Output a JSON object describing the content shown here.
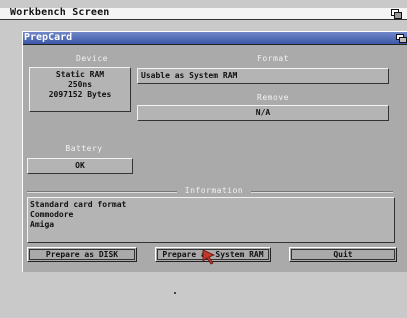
{
  "screen": {
    "title": "Workbench Screen"
  },
  "window": {
    "title": "PrepCard"
  },
  "device": {
    "label": "Device",
    "lines": [
      "Static RAM",
      "250ns",
      "2097152 Bytes"
    ]
  },
  "format": {
    "label": "Format",
    "value": "Usable as System RAM"
  },
  "remove": {
    "label": "Remove",
    "value": "N/A"
  },
  "battery": {
    "label": "Battery",
    "value": "OK"
  },
  "information": {
    "label": "Information",
    "lines": [
      "Standard card format",
      "Commodore",
      "Amiga"
    ]
  },
  "buttons": {
    "prepare_disk": "Prepare as DISK",
    "prepare_ram": "Prepare as System RAM",
    "quit": "Quit"
  },
  "colors": {
    "titlebar": "#3d58a8",
    "window_bg": "#aaaaaa",
    "screen_bg": "#c9c9c9"
  }
}
